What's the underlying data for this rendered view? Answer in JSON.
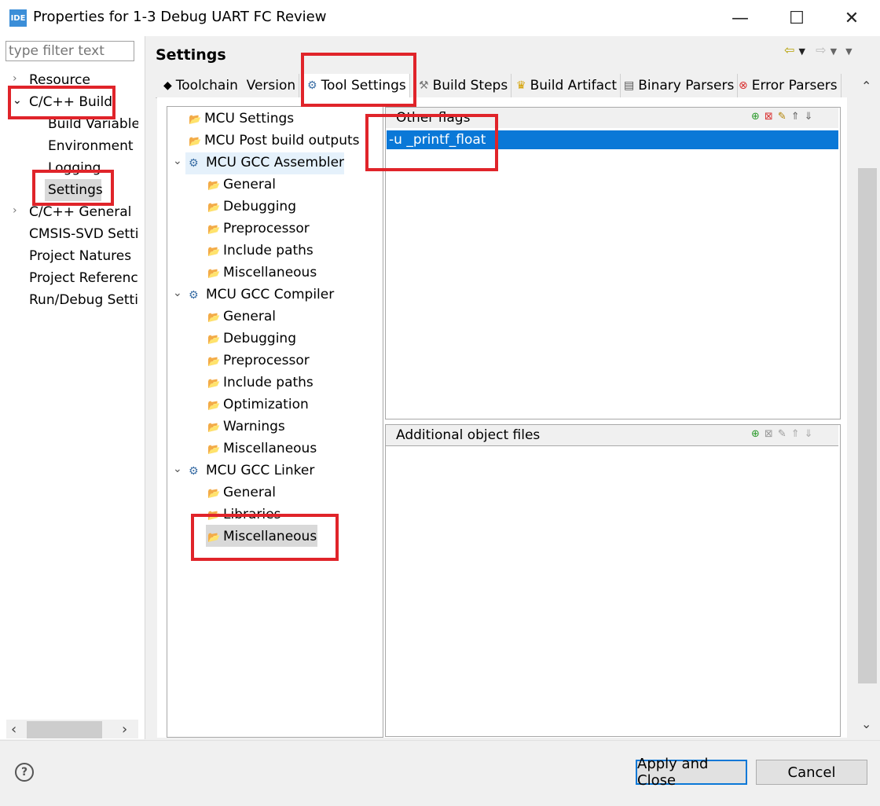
{
  "window": {
    "icon_label": "IDE",
    "title": "Properties for 1-3 Debug UART FC Review",
    "minimize": "—",
    "maximize": "☐",
    "close": "✕"
  },
  "left": {
    "filter_placeholder": "type filter text",
    "items": [
      {
        "label": "Resource",
        "level": 0,
        "expand": "›"
      },
      {
        "label": "C/C++ Build",
        "level": 0,
        "expand": "⌄"
      },
      {
        "label": "Build Variables",
        "level": 1
      },
      {
        "label": "Environment",
        "level": 1
      },
      {
        "label": "Logging",
        "level": 1
      },
      {
        "label": "Settings",
        "level": 1,
        "selected": true
      },
      {
        "label": "C/C++ General",
        "level": 0,
        "expand": "›"
      },
      {
        "label": "CMSIS-SVD Settings",
        "level": 0
      },
      {
        "label": "Project Natures",
        "level": 0
      },
      {
        "label": "Project References",
        "level": 0
      },
      {
        "label": "Run/Debug Settings",
        "level": 0
      }
    ],
    "scroll_left": "‹",
    "scroll_right": "›"
  },
  "header": {
    "title": "Settings"
  },
  "tabs": [
    {
      "label": "Toolchain  Version"
    },
    {
      "label": "Tool Settings",
      "active": true
    },
    {
      "label": "Build Steps"
    },
    {
      "label": "Build Artifact"
    },
    {
      "label": "Binary Parsers"
    },
    {
      "label": "Error Parsers"
    }
  ],
  "tree": [
    {
      "label": "MCU Settings"
    },
    {
      "label": "MCU Post build outputs"
    },
    {
      "label": "MCU GCC Assembler"
    },
    {
      "label": "General"
    },
    {
      "label": "Debugging"
    },
    {
      "label": "Preprocessor"
    },
    {
      "label": "Include paths"
    },
    {
      "label": "Miscellaneous"
    },
    {
      "label": "MCU GCC Compiler"
    },
    {
      "label": "General"
    },
    {
      "label": "Debugging"
    },
    {
      "label": "Preprocessor"
    },
    {
      "label": "Include paths"
    },
    {
      "label": "Optimization"
    },
    {
      "label": "Warnings"
    },
    {
      "label": "Miscellaneous"
    },
    {
      "label": "MCU GCC Linker"
    },
    {
      "label": "General"
    },
    {
      "label": "Libraries"
    },
    {
      "label": "Miscellaneous",
      "selected": true
    }
  ],
  "other_flags": {
    "label": "Other flags",
    "values": [
      "-u _printf_float"
    ]
  },
  "additional_objects": {
    "label": "Additional object files"
  },
  "buttons": {
    "help": "?",
    "apply_close": "Apply and Close",
    "cancel": "Cancel"
  },
  "colors": {
    "accent": "#0a78d7",
    "highlight_box": "#e0242a"
  }
}
